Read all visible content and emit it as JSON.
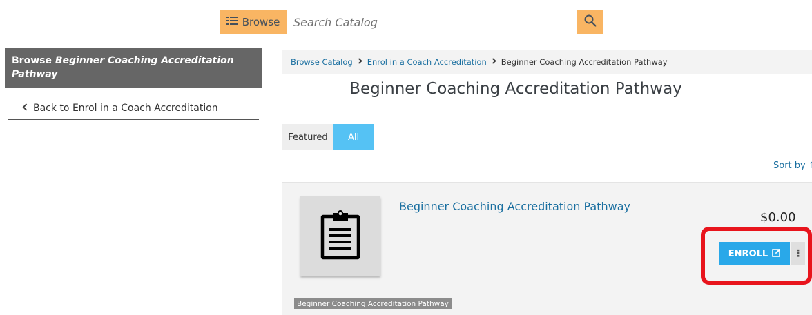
{
  "search": {
    "browse_label": "Browse",
    "placeholder": "Search Catalog",
    "value": ""
  },
  "sidebar": {
    "header_prefix": "Browse",
    "header_title": "Beginner Coaching Accreditation Pathway",
    "back_label": "Back to Enrol in a Coach Accreditation"
  },
  "breadcrumb": {
    "items": [
      "Browse Catalog",
      "Enrol in a Coach Accreditation"
    ],
    "current": "Beginner Coaching Accreditation Pathway"
  },
  "page_title": "Beginner Coaching Accreditation Pathway",
  "tabs": [
    {
      "label": "Featured",
      "active": false
    },
    {
      "label": "All",
      "active": true
    }
  ],
  "sort_label": "Sort by",
  "course": {
    "title": "Beginner Coaching Accreditation Pathway",
    "price": "$0.00",
    "enroll_label": "ENROLL",
    "tag": "Beginner Coaching Accreditation Pathway",
    "icon": "clipboard-icon"
  },
  "colors": {
    "accent_orange": "#f9b563",
    "accent_blue": "#29a8e9",
    "tab_active": "#55c2f4",
    "link": "#1a6fa0",
    "highlight_red": "#e8141c",
    "sidebar_header": "#666666"
  }
}
